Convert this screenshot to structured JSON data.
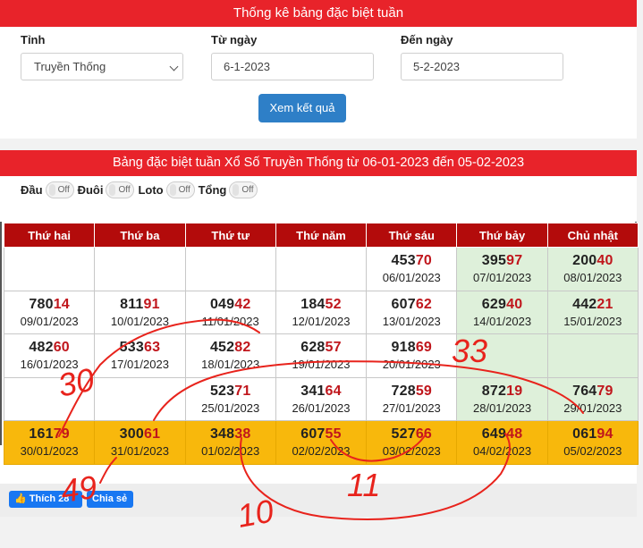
{
  "filter": {
    "title": "Thống kê bảng đặc biệt tuần",
    "province_label": "Tỉnh",
    "province_value": "Truyền Thống",
    "from_label": "Từ ngày",
    "from_value": "6-1-2023",
    "to_label": "Đến ngày",
    "to_value": "5-2-2023",
    "submit_label": "Xem kết quả"
  },
  "result": {
    "title": "Bảng đặc biệt tuần Xổ Số Truyền Thống từ 06-01-2023 đến 05-02-2023",
    "toggles": [
      {
        "label": "Đầu",
        "state": "Off"
      },
      {
        "label": "Đuôi",
        "state": "Off"
      },
      {
        "label": "Loto",
        "state": "Off"
      },
      {
        "label": "Tổng",
        "state": "Off"
      }
    ],
    "columns": [
      "Thứ hai",
      "Thứ ba",
      "Thứ tư",
      "Thứ năm",
      "Thứ sáu",
      "Thứ bảy",
      "Chủ nhật"
    ],
    "rows": [
      [
        null,
        null,
        null,
        null,
        {
          "head": "453",
          "tail": "70",
          "date": "06/01/2023"
        },
        {
          "head": "395",
          "tail": "97",
          "date": "07/01/2023"
        },
        {
          "head": "200",
          "tail": "40",
          "date": "08/01/2023"
        }
      ],
      [
        {
          "head": "780",
          "tail": "14",
          "date": "09/01/2023"
        },
        {
          "head": "811",
          "tail": "91",
          "date": "10/01/2023"
        },
        {
          "head": "049",
          "tail": "42",
          "date": "11/01/2023"
        },
        {
          "head": "184",
          "tail": "52",
          "date": "12/01/2023"
        },
        {
          "head": "607",
          "tail": "62",
          "date": "13/01/2023"
        },
        {
          "head": "629",
          "tail": "40",
          "date": "14/01/2023"
        },
        {
          "head": "442",
          "tail": "21",
          "date": "15/01/2023"
        }
      ],
      [
        {
          "head": "482",
          "tail": "60",
          "date": "16/01/2023"
        },
        {
          "head": "533",
          "tail": "63",
          "date": "17/01/2023"
        },
        {
          "head": "452",
          "tail": "82",
          "date": "18/01/2023"
        },
        {
          "head": "628",
          "tail": "57",
          "date": "19/01/2023"
        },
        {
          "head": "918",
          "tail": "69",
          "date": "20/01/2023"
        },
        null,
        null
      ],
      [
        null,
        null,
        {
          "head": "523",
          "tail": "71",
          "date": "25/01/2023"
        },
        {
          "head": "341",
          "tail": "64",
          "date": "26/01/2023"
        },
        {
          "head": "728",
          "tail": "59",
          "date": "27/01/2023"
        },
        {
          "head": "872",
          "tail": "19",
          "date": "28/01/2023"
        },
        {
          "head": "764",
          "tail": "79",
          "date": "29/01/2023"
        }
      ],
      [
        {
          "head": "161",
          "tail": "79",
          "date": "30/01/2023"
        },
        {
          "head": "300",
          "tail": "61",
          "date": "31/01/2023"
        },
        {
          "head": "348",
          "tail": "38",
          "date": "01/02/2023"
        },
        {
          "head": "607",
          "tail": "55",
          "date": "02/02/2023"
        },
        {
          "head": "527",
          "tail": "66",
          "date": "03/02/2023"
        },
        {
          "head": "649",
          "tail": "48",
          "date": "04/02/2023"
        },
        {
          "head": "061",
          "tail": "94",
          "date": "05/02/2023"
        }
      ]
    ]
  },
  "social": {
    "like_label": "Thích 28",
    "share_label": "Chia sẻ"
  },
  "handwriting": {
    "n30": "30",
    "n33": "33",
    "n49": "49",
    "n11": "11",
    "n10": "10"
  },
  "colors": {
    "banner": "#e8232a",
    "table_header": "#b30b0b",
    "weekend_cell": "#def0da",
    "highlight_row": "#f8b80c",
    "ink": "#e8231c",
    "button": "#2e7fc7"
  }
}
